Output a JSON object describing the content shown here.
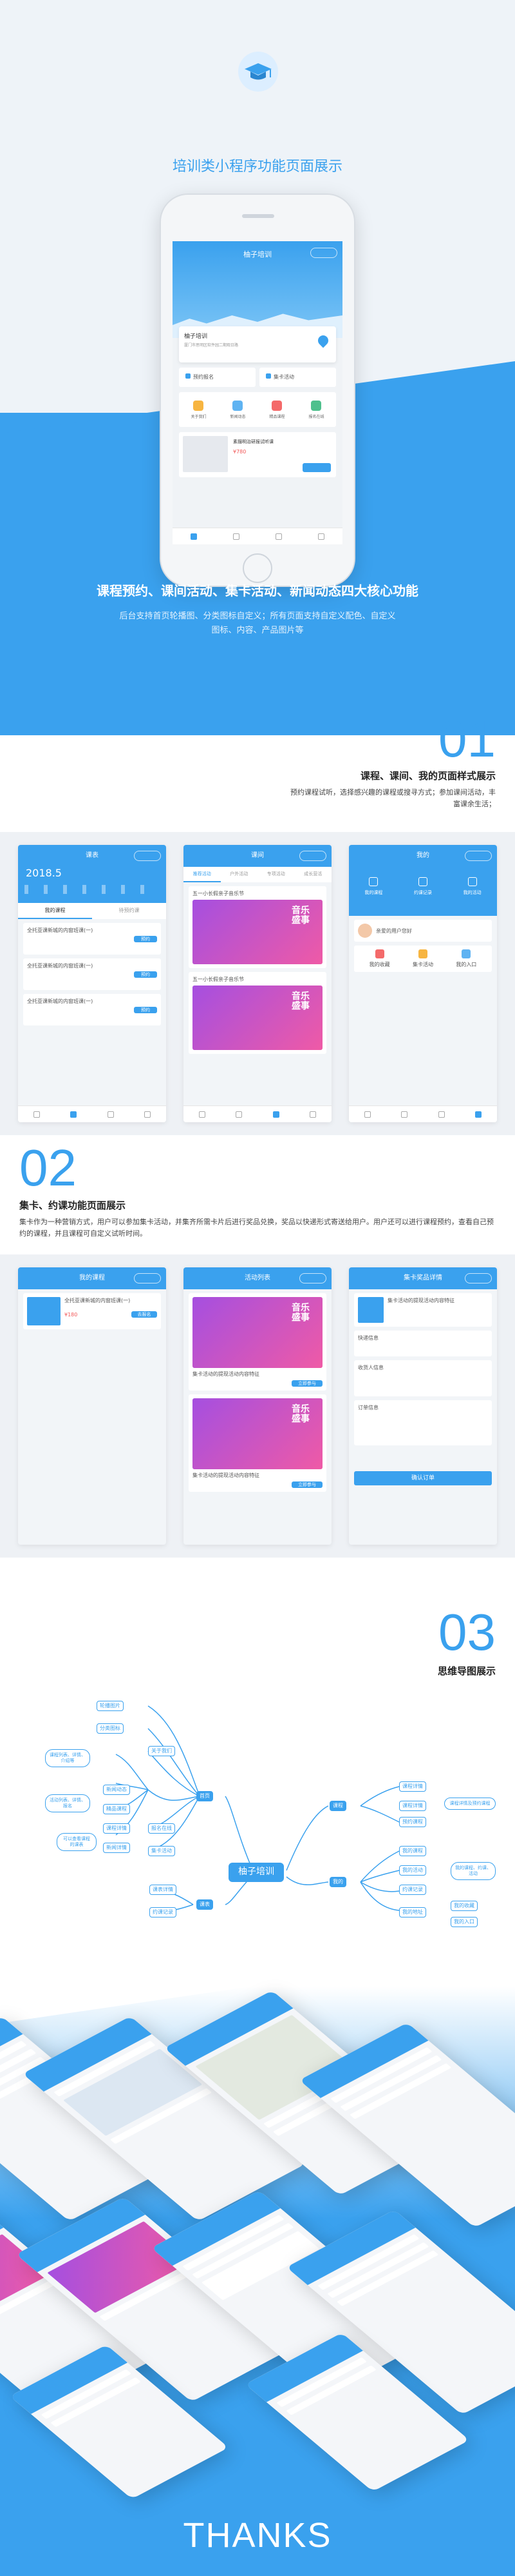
{
  "header": {
    "title": "培训类小程序功能页面展示",
    "app_name": "柚子培训",
    "shop_name": "柚子培训",
    "shop_address": "厦门市思明区软件园二期观日路",
    "shop_menu": [
      {
        "label": "预约报名",
        "icon": "calendar-icon"
      },
      {
        "label": "集卡活动",
        "icon": "card-icon"
      }
    ],
    "grid": [
      {
        "label": "关于我们",
        "color": "#f7b541"
      },
      {
        "label": "新闻动态",
        "color": "#5fb3f2"
      },
      {
        "label": "精品课程",
        "color": "#f46a6a"
      },
      {
        "label": "报名在线",
        "color": "#4fc08d"
      }
    ],
    "course_title": "素描明治研报试听课",
    "course_price": "¥780"
  },
  "intro": {
    "heading": "课程预约、课间活动、集卡活动、新闻动态四大核心功能",
    "desc": "后台支持首页轮播图、分类图标自定义；所有页面支持自定义配色、自定义图标、内容、产品图片等"
  },
  "section1": {
    "number": "01",
    "title": "课程、课间、我的页面样式展示",
    "desc": "预约课程试听，选择感兴趣的课程或搜寻方式；参加课间活动，丰富课余生活；",
    "screen1": {
      "title": "课表",
      "date": "2018.5",
      "tabs": [
        "我的课程",
        "待预约课"
      ],
      "items": [
        "全托亚课新城的内窗班课(一)",
        "全托亚课新城的内窗班课(一)",
        "全托亚课新城的内窗班课(一)"
      ],
      "btn": "预约"
    },
    "screen2": {
      "title": "课间",
      "tabs": [
        "推荐活动",
        "户外活动",
        "专项活动",
        "成长营活"
      ],
      "card1": "五一小长假亲子音乐节",
      "card2": "五一小长假亲子音乐节",
      "poster_text": "音乐盛事"
    },
    "screen3": {
      "title": "我的",
      "icons": [
        "我的课程",
        "约课记录",
        "我的活动"
      ],
      "msg": "亲爱的用户您好",
      "grid": [
        "我的收藏",
        "集卡活动",
        "我的入口"
      ]
    }
  },
  "section2": {
    "number": "02",
    "title": "集卡、约课功能页面展示",
    "desc": "集卡作为一种营销方式，用户可以参加集卡活动，并集齐所需卡片后进行奖品兑换，奖品以快递形式寄送给用户。用户还可以进行课程预约，查看自己预约的课程，并且课程可自定义试听时间。",
    "screen1": {
      "title": "我的课程",
      "item": "全托亚课新城的内窗班课(一)",
      "price": "¥180",
      "btn": "去报名"
    },
    "screen2": {
      "title": "活动列表",
      "card1": "集卡活动的提现活动内容特征",
      "card2": "集卡活动的提现活动内容特征",
      "btn": "立即参与"
    },
    "screen3": {
      "title": "集卡奖品详情",
      "item": "集卡活动的提现活动内容特征",
      "sections": [
        "快递信息",
        "收货人信息",
        "订单信息"
      ],
      "btn": "确认订单"
    }
  },
  "section3": {
    "number": "03",
    "title": "思维导图展示",
    "center": "柚子培训",
    "branches": {
      "home": "首页",
      "course": "课程",
      "me": "我的",
      "news": "课表"
    },
    "home_nodes": [
      "轮播图片",
      "分类图标",
      "关于我们",
      "新闻动态",
      "精品课程",
      "课程详情",
      "新闻详情",
      "报名在线",
      "集卡活动"
    ],
    "course_nodes": [
      "课程详情",
      "课程详情",
      "预约课程"
    ],
    "me_nodes": [
      "我的课程",
      "我的活动",
      "约课记录",
      "我的收藏",
      "我的入口",
      "我的地址"
    ],
    "news_nodes": [
      "课表详情",
      "约课记录"
    ],
    "notes": [
      "课程列表、详情、介绍等",
      "活动列表、详情、报名",
      "可以查看课程的课表",
      "课程详情及预约课程",
      "我的课程、约课、活动"
    ]
  },
  "footer": {
    "thanks": "THANKS"
  },
  "colors": {
    "accent": "#3aa1ee",
    "poster_start": "#a54fe0",
    "poster_end": "#ef5aa6"
  }
}
